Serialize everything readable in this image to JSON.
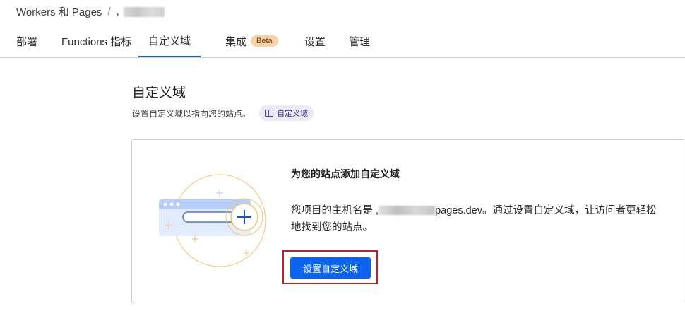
{
  "breadcrumb": {
    "root": "Workers 和 Pages",
    "separator": "/",
    "project": ",",
    "project_redacted": true
  },
  "tabs": [
    {
      "label": "部署",
      "active": false
    },
    {
      "label": "Functions 指标",
      "active": false
    },
    {
      "label": "自定义域",
      "active": true
    },
    {
      "label": "集成",
      "badge": "Beta",
      "active": false
    },
    {
      "label": "设置",
      "active": false
    },
    {
      "label": "管理",
      "active": false
    }
  ],
  "section": {
    "title": "自定义域",
    "description": "设置自定义域以指向您的站点。",
    "doc_link_label": "自定义域"
  },
  "card": {
    "title": "为您的站点添加自定义域",
    "text_prefix": "您项目的主机名是 ,",
    "text_hostname_suffix": "pages.dev",
    "text_suffix": "。通过设置自定义域，让访问者更轻松地找到您的站点。",
    "button_label": "设置自定义域"
  },
  "colors": {
    "accent": "#0b63f0",
    "tab_active": "#1f5fbf",
    "badge_bg": "#fbd2a8",
    "highlight_frame": "#c41d2c"
  }
}
